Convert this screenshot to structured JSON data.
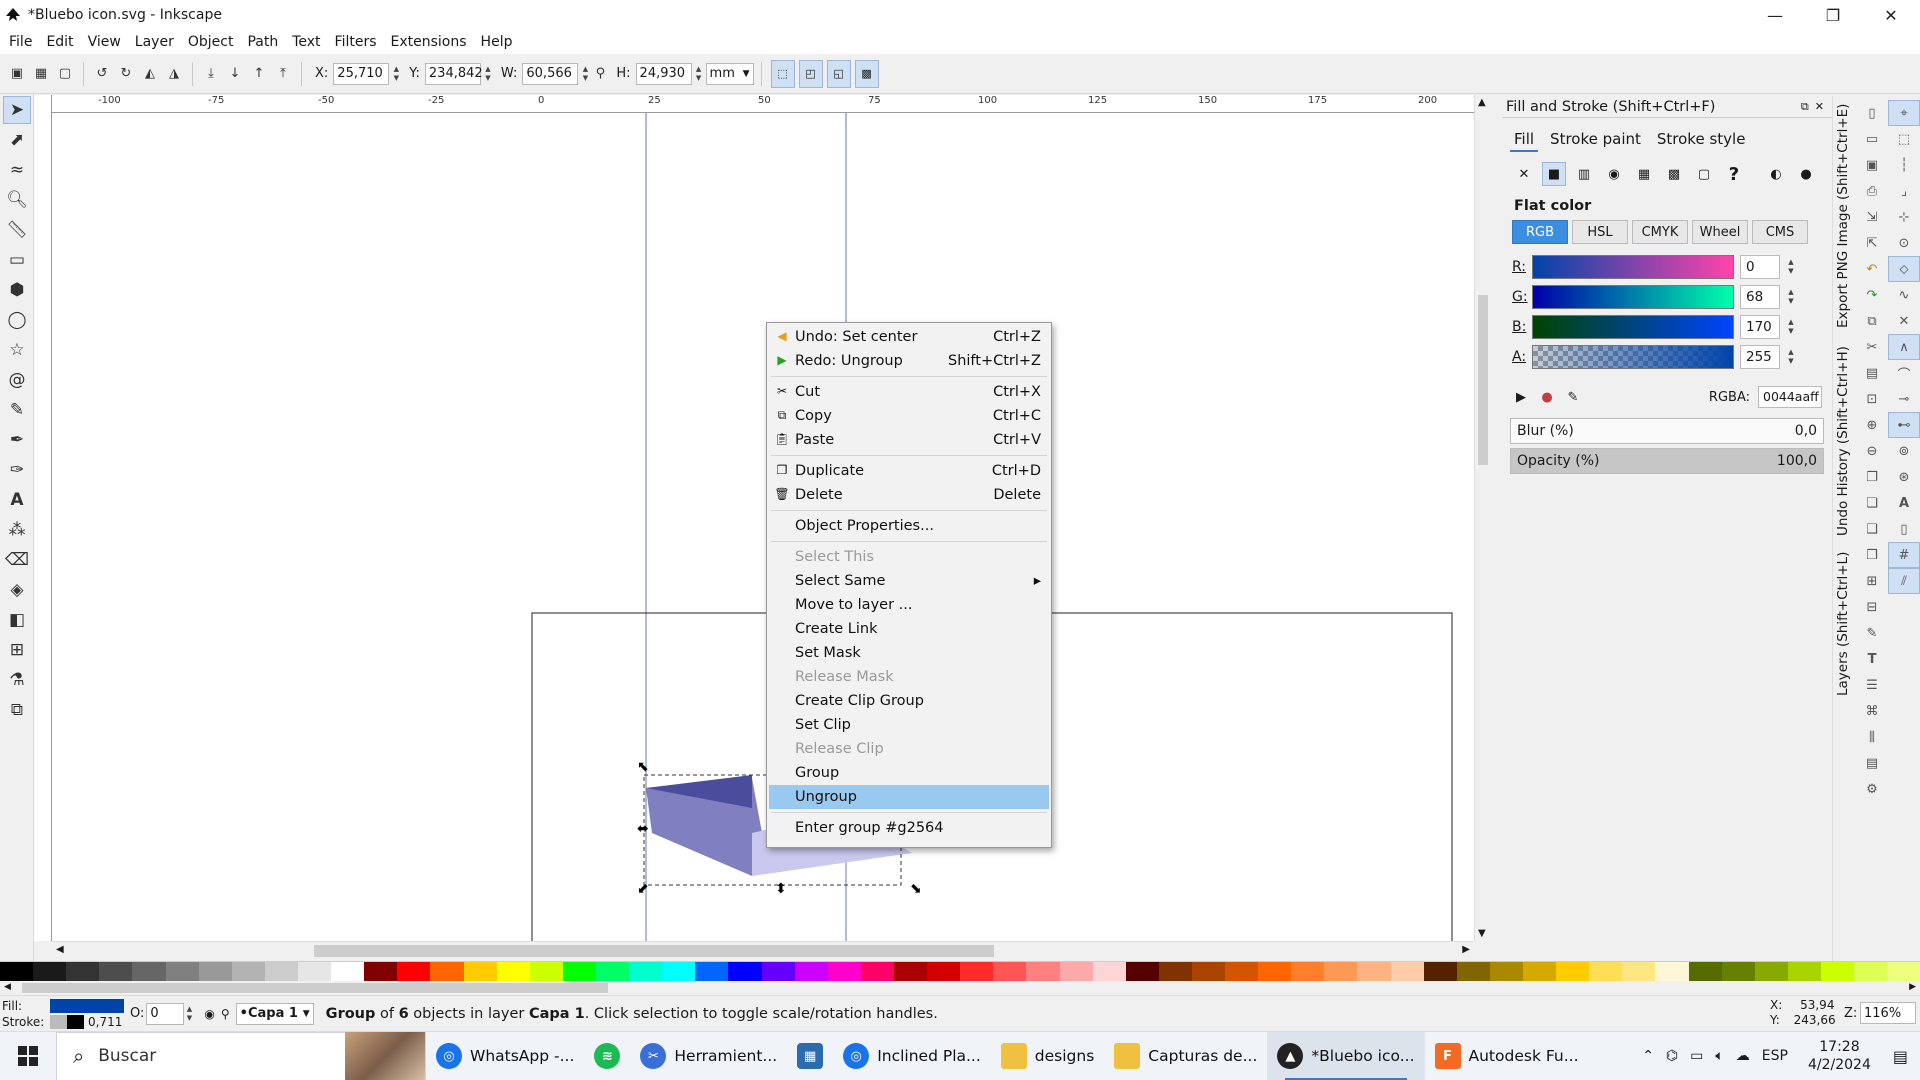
{
  "window": {
    "title": "*Bluebo icon.svg - Inkscape",
    "controls": [
      "—",
      "❐",
      "✕"
    ]
  },
  "menu": [
    "File",
    "Edit",
    "View",
    "Layer",
    "Object",
    "Path",
    "Text",
    "Filters",
    "Extensions",
    "Help"
  ],
  "toolbar": {
    "x_label": "X:",
    "x_value": "25,710",
    "y_label": "Y:",
    "y_value": "234,842",
    "w_label": "W:",
    "w_value": "60,566",
    "h_label": "H:",
    "h_value": "24,930",
    "unit": "mm"
  },
  "ruler_labels": [
    "-100",
    "-75",
    "-50",
    "-25",
    "0",
    "25",
    "50",
    "75",
    "100",
    "125",
    "150",
    "175",
    "200"
  ],
  "context_menu": {
    "items": [
      {
        "label": "Undo: Set center",
        "shortcut": "Ctrl+Z",
        "icon": "undo-icon",
        "state": "normal"
      },
      {
        "label": "Redo: Ungroup",
        "shortcut": "Shift+Ctrl+Z",
        "icon": "redo-icon",
        "state": "normal"
      },
      {
        "label": "Cut",
        "shortcut": "Ctrl+X",
        "icon": "cut-icon",
        "state": "normal"
      },
      {
        "label": "Copy",
        "shortcut": "Ctrl+C",
        "icon": "copy-icon",
        "state": "normal"
      },
      {
        "label": "Paste",
        "shortcut": "Ctrl+V",
        "icon": "paste-icon",
        "state": "normal"
      },
      {
        "label": "Duplicate",
        "shortcut": "Ctrl+D",
        "icon": "duplicate-icon",
        "state": "normal"
      },
      {
        "label": "Delete",
        "shortcut": "Delete",
        "icon": "delete-icon",
        "state": "normal"
      },
      {
        "label": "Object Properties...",
        "shortcut": "",
        "icon": "",
        "state": "normal"
      },
      {
        "label": "Select This",
        "shortcut": "",
        "icon": "",
        "state": "disabled"
      },
      {
        "label": "Select Same",
        "shortcut": "▸",
        "icon": "",
        "state": "normal"
      },
      {
        "label": "Move to layer ...",
        "shortcut": "",
        "icon": "",
        "state": "normal"
      },
      {
        "label": "Create Link",
        "shortcut": "",
        "icon": "",
        "state": "normal"
      },
      {
        "label": "Set Mask",
        "shortcut": "",
        "icon": "",
        "state": "normal"
      },
      {
        "label": "Release Mask",
        "shortcut": "",
        "icon": "",
        "state": "disabled"
      },
      {
        "label": "Create Clip Group",
        "shortcut": "",
        "icon": "",
        "state": "normal"
      },
      {
        "label": "Set Clip",
        "shortcut": "",
        "icon": "",
        "state": "normal"
      },
      {
        "label": "Release Clip",
        "shortcut": "",
        "icon": "",
        "state": "disabled"
      },
      {
        "label": "Group",
        "shortcut": "",
        "icon": "",
        "state": "normal"
      },
      {
        "label": "Ungroup",
        "shortcut": "",
        "icon": "",
        "state": "selected"
      },
      {
        "label": "Enter group #g2564",
        "shortcut": "",
        "icon": "",
        "state": "normal"
      }
    ]
  },
  "fill_stroke": {
    "title": "Fill and Stroke (Shift+Ctrl+F)",
    "tabs": [
      "Fill",
      "Stroke paint",
      "Stroke style"
    ],
    "mode_title": "Flat color",
    "color_tabs": [
      "RGB",
      "HSL",
      "CMYK",
      "Wheel",
      "CMS"
    ],
    "channels": [
      {
        "label": "R:",
        "value": "0"
      },
      {
        "label": "G:",
        "value": "68"
      },
      {
        "label": "B:",
        "value": "170"
      },
      {
        "label": "A:",
        "value": "255"
      }
    ],
    "rgba_label": "RGBA:",
    "rgba_value": "0044aaff",
    "blur_label": "Blur (%)",
    "blur_value": "0,0",
    "opacity_label": "Opacity (%)",
    "opacity_value": "100,0"
  },
  "side_tabs": [
    "Export PNG Image (Shift+Ctrl+E)",
    "Undo History (Shift+Ctrl+H)",
    "Layers (Shift+Ctrl+L)"
  ],
  "status": {
    "fill_label": "Fill:",
    "stroke_label": "Stroke:",
    "stroke_width": "0,711",
    "opacity_label": "O:",
    "opacity_value": "0",
    "layer": "•Capa 1",
    "message_bold": "Group",
    "message_1": " of ",
    "message_count": "6",
    "message_2": " objects in layer ",
    "message_layer": "Capa 1",
    "message_3": ". Click selection to toggle scale/rotation handles.",
    "cursor_x_label": "X:",
    "cursor_x": "53,94",
    "cursor_y_label": "Y:",
    "cursor_y": "243,66",
    "zoom_label": "Z:",
    "zoom": "116%"
  },
  "taskbar": {
    "search": "Buscar",
    "apps": [
      {
        "label": "WhatsApp -...",
        "icon": "chrome-icon",
        "color": "#1a73e8"
      },
      {
        "label": "",
        "icon": "spotify-icon",
        "color": "#1db954"
      },
      {
        "label": "Herramient...",
        "icon": "snipping-tool-icon",
        "color": "#3a6fd8"
      },
      {
        "label": "",
        "icon": "calculator-icon",
        "color": "#2b6cb0"
      },
      {
        "label": "Inclined Pla...",
        "icon": "chrome-icon",
        "color": "#1a73e8"
      },
      {
        "label": "designs",
        "icon": "folder-icon",
        "color": "#f0c040"
      },
      {
        "label": "Capturas de...",
        "icon": "folder-icon",
        "color": "#f0c040"
      },
      {
        "label": "*Bluebo ico...",
        "icon": "inkscape-icon",
        "color": "#222222"
      },
      {
        "label": "Autodesk Fu...",
        "icon": "fusion-icon",
        "color": "#f26b22"
      }
    ],
    "language": "ESP",
    "time": "17:28",
    "date": "4/2/2024"
  },
  "colors": {
    "accent": "#3c78c8",
    "fill_color": "#0044aa",
    "selection_highlight": "#99c9ef"
  }
}
